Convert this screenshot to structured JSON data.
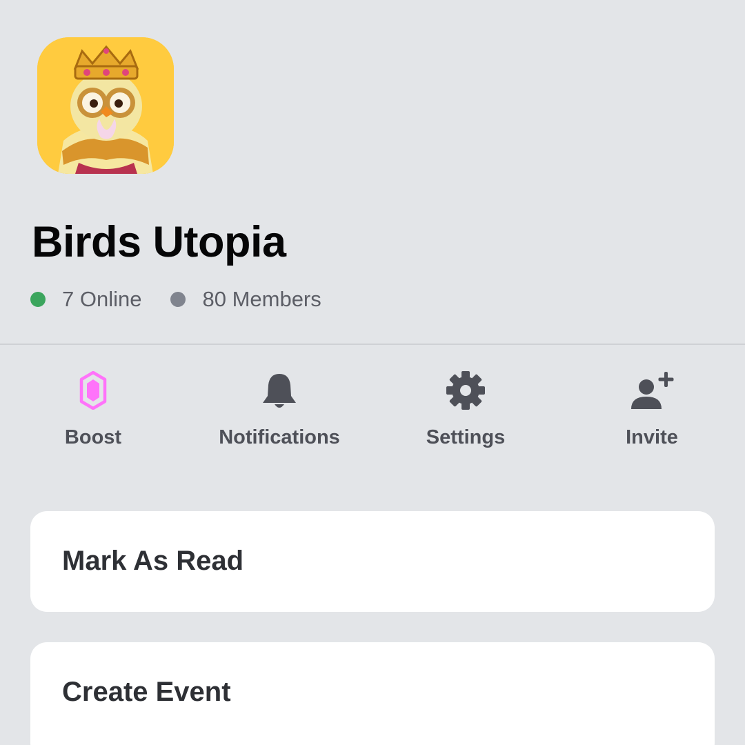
{
  "server": {
    "name": "Birds Utopia",
    "icon": "owl-king-avatar-icon",
    "stats": {
      "online": "7 Online",
      "members": "80 Members"
    }
  },
  "colors": {
    "online_dot": "#3ba55d",
    "members_dot": "#80848e",
    "boost_accent": "#ff73fa",
    "icon_gray": "#4e5058"
  },
  "actions": [
    {
      "label": "Boost",
      "icon": "boost-gem-icon"
    },
    {
      "label": "Notifications",
      "icon": "bell-icon"
    },
    {
      "label": "Settings",
      "icon": "gear-icon"
    },
    {
      "label": "Invite",
      "icon": "add-person-icon"
    }
  ],
  "menu": [
    {
      "label": "Mark As Read"
    },
    {
      "label": "Create Event"
    }
  ]
}
